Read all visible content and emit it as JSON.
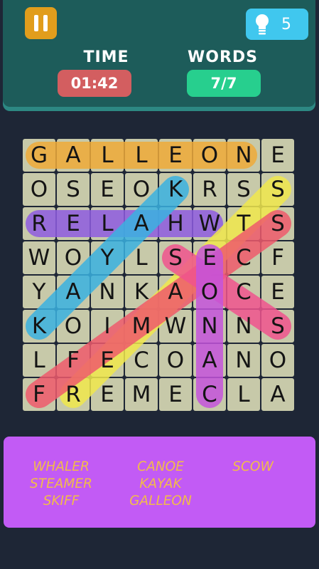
{
  "header": {
    "pause_icon": "pause-icon",
    "hint_icon": "lightbulb-icon",
    "hints": "5",
    "time_label": "TIME",
    "time_value": "01:42",
    "words_label": "WORDS",
    "words_value": "7/7"
  },
  "colors": {
    "header_bg": "#1d5c5a",
    "pause_bg": "#e19d1c",
    "hint_bg": "#40c7ee",
    "time_box": "#d35e60",
    "words_box": "#27cf8e",
    "cell": "#c7c9a9",
    "panel": "#c25bf5",
    "word_text": "#f2bb4a"
  },
  "grid": [
    [
      "G",
      "A",
      "L",
      "L",
      "E",
      "O",
      "N",
      "E"
    ],
    [
      "O",
      "S",
      "E",
      "O",
      "K",
      "R",
      "S",
      "S"
    ],
    [
      "R",
      "E",
      "L",
      "A",
      "H",
      "W",
      "T",
      "S"
    ],
    [
      "W",
      "O",
      "Y",
      "L",
      "S",
      "E",
      "C",
      "F"
    ],
    [
      "Y",
      "A",
      "N",
      "K",
      "A",
      "O",
      "C",
      "E"
    ],
    [
      "K",
      "O",
      "I",
      "M",
      "W",
      "N",
      "N",
      "S"
    ],
    [
      "L",
      "F",
      "E",
      "C",
      "O",
      "A",
      "N",
      "O"
    ],
    [
      "F",
      "R",
      "E",
      "M",
      "E",
      "C",
      "L",
      "A"
    ]
  ],
  "found": [
    {
      "word": "GALLEON",
      "from": [
        0,
        0
      ],
      "to": [
        0,
        6
      ],
      "color": "#eeaa38"
    },
    {
      "word": "WHALER",
      "from": [
        2,
        5
      ],
      "to": [
        2,
        0
      ],
      "color": "#8e5ce0"
    },
    {
      "word": "KAYAK",
      "from": [
        1,
        4
      ],
      "to": [
        5,
        0
      ],
      "color": "#3ab1e0"
    },
    {
      "word": "STEAMER",
      "from": [
        1,
        7
      ],
      "to": [
        7,
        1
      ],
      "color": "#f0e84c"
    },
    {
      "word": "SKIFF",
      "from": [
        2,
        7
      ],
      "to": [
        7,
        0
      ],
      "color": "#ee5a6c"
    },
    {
      "word": "SCOW",
      "from": [
        3,
        4
      ],
      "to": [
        5,
        7
      ],
      "color": "#f0538e"
    },
    {
      "word": "CANOE",
      "from": [
        7,
        5
      ],
      "to": [
        3,
        5
      ],
      "color": "#c454dc"
    }
  ],
  "words": {
    "col1": [
      "WHALER",
      "STEAMER",
      "SKIFF"
    ],
    "col2": [
      "CANOE",
      "KAYAK",
      "GALLEON"
    ],
    "col3": [
      "SCOW"
    ]
  }
}
